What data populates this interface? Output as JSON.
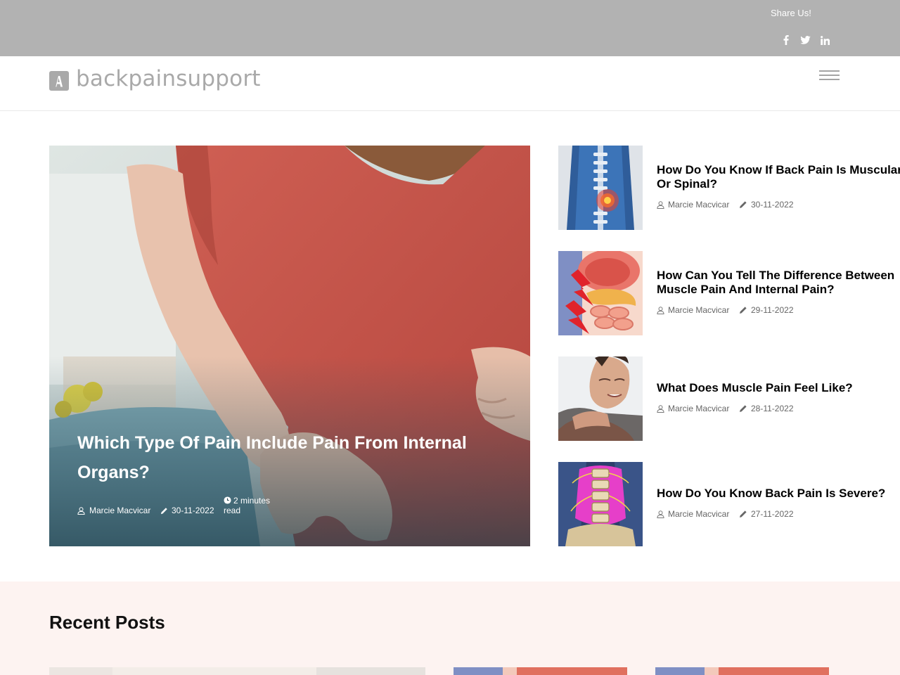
{
  "topbar": {
    "share_label": "Share Us!",
    "social": [
      {
        "icon": "facebook-icon"
      },
      {
        "icon": "twitter-icon"
      },
      {
        "icon": "linkedin-icon"
      }
    ]
  },
  "header": {
    "logo_text": "backpainsupport",
    "logo_letter": "A",
    "menu_icon": "hamburger-menu-icon"
  },
  "hero": {
    "title": "Which Type Of Pain Include Pain From Internal Organs?",
    "author": "Marcie Macvicar",
    "date": "30-11-2022",
    "read_time": "2 minutes read"
  },
  "side_posts": [
    {
      "title_line1": "How Do You Know If Back Pain Is Muscular",
      "title_line2": "Or Spinal?",
      "author": "Marcie Macvicar",
      "date": "30-11-2022"
    },
    {
      "title_line1": "How Can You Tell The Difference Between",
      "title_line2": "Muscle Pain And Internal Pain?",
      "author": "Marcie Macvicar",
      "date": "29-11-2022"
    },
    {
      "title_line1": "What Does Muscle Pain Feel Like?",
      "title_line2": "",
      "author": "Marcie Macvicar",
      "date": "28-11-2022"
    },
    {
      "title_line1": "How Do You Know Back Pain Is Severe?",
      "title_line2": "",
      "author": "Marcie Macvicar",
      "date": "27-11-2022"
    }
  ],
  "recent": {
    "heading": "Recent Posts"
  },
  "colors": {
    "topbar_bg": "#b2b2b2",
    "logo_grey": "#a9a9a9",
    "recent_bg": "#fdf3f1",
    "shirt_red": "#c9584d"
  }
}
